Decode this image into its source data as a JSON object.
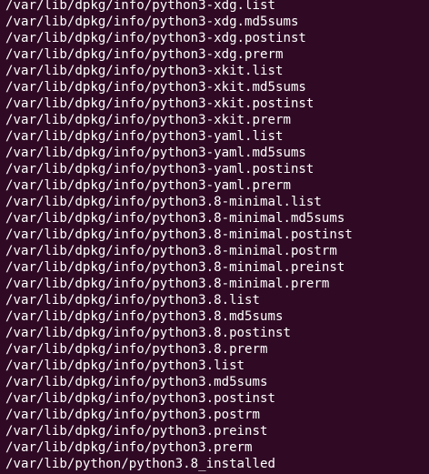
{
  "terminal": {
    "background": "#300a24",
    "foreground": "#ffffff",
    "lines": [
      "/var/lib/dpkg/info/python3-xdg.list",
      "/var/lib/dpkg/info/python3-xdg.md5sums",
      "/var/lib/dpkg/info/python3-xdg.postinst",
      "/var/lib/dpkg/info/python3-xdg.prerm",
      "/var/lib/dpkg/info/python3-xkit.list",
      "/var/lib/dpkg/info/python3-xkit.md5sums",
      "/var/lib/dpkg/info/python3-xkit.postinst",
      "/var/lib/dpkg/info/python3-xkit.prerm",
      "/var/lib/dpkg/info/python3-yaml.list",
      "/var/lib/dpkg/info/python3-yaml.md5sums",
      "/var/lib/dpkg/info/python3-yaml.postinst",
      "/var/lib/dpkg/info/python3-yaml.prerm",
      "/var/lib/dpkg/info/python3.8-minimal.list",
      "/var/lib/dpkg/info/python3.8-minimal.md5sums",
      "/var/lib/dpkg/info/python3.8-minimal.postinst",
      "/var/lib/dpkg/info/python3.8-minimal.postrm",
      "/var/lib/dpkg/info/python3.8-minimal.preinst",
      "/var/lib/dpkg/info/python3.8-minimal.prerm",
      "/var/lib/dpkg/info/python3.8.list",
      "/var/lib/dpkg/info/python3.8.md5sums",
      "/var/lib/dpkg/info/python3.8.postinst",
      "/var/lib/dpkg/info/python3.8.prerm",
      "/var/lib/dpkg/info/python3.list",
      "/var/lib/dpkg/info/python3.md5sums",
      "/var/lib/dpkg/info/python3.postinst",
      "/var/lib/dpkg/info/python3.postrm",
      "/var/lib/dpkg/info/python3.preinst",
      "/var/lib/dpkg/info/python3.prerm",
      "/var/lib/python/python3.8_installed"
    ]
  }
}
